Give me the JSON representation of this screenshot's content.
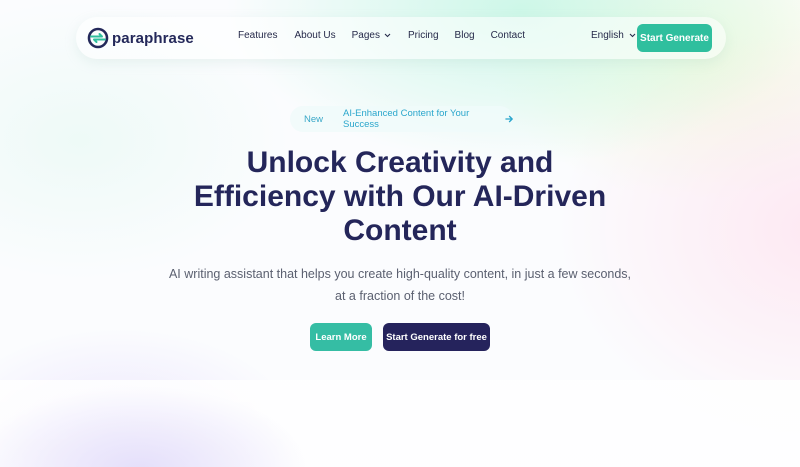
{
  "brand": {
    "name": "paraphrase",
    "logo_icon": "paraphrase-logo-icon"
  },
  "nav": {
    "items": [
      {
        "label": "Features",
        "has_dropdown": false
      },
      {
        "label": "About Us",
        "has_dropdown": false
      },
      {
        "label": "Pages",
        "has_dropdown": true
      },
      {
        "label": "Pricing",
        "has_dropdown": false
      },
      {
        "label": "Blog",
        "has_dropdown": false
      },
      {
        "label": "Contact",
        "has_dropdown": false
      }
    ],
    "language": "English",
    "cta_label": "Start Generate"
  },
  "badge": {
    "tag": "New",
    "text": "AI-Enhanced Content for Your Success",
    "icon": "arrow-right-icon"
  },
  "hero": {
    "title_line1": "Unlock Creativity and",
    "title_line2": "Efficiency with Our AI-Driven",
    "title_line3": "Content",
    "subtitle_line1": "AI writing assistant that helps you create high-quality content, in just a few seconds,",
    "subtitle_line2": "at a fraction of the cost!",
    "primary_button": "Learn More",
    "secondary_button": "Start Generate for free"
  },
  "colors": {
    "accent": "#2fbf9e",
    "navy": "#25235c",
    "badge_text": "#2aa6cc",
    "text": "#24265a"
  }
}
